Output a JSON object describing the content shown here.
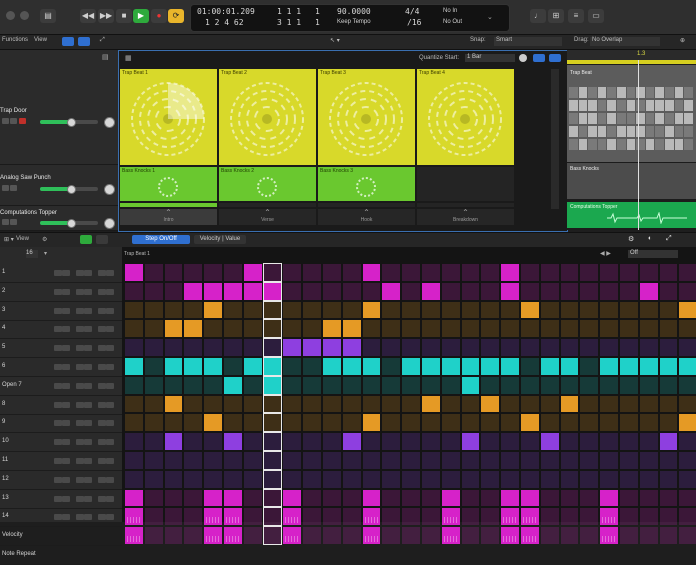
{
  "transport": {
    "position": "01:00:01.209",
    "bars_top": "1  1  1",
    "bars_top2": "1",
    "bars_bot": "1  2  4  62",
    "bars_bot2": "3  1  1",
    "bars_bot3": "1",
    "tempo": "90.0000",
    "tempo_label": "Keep Tempo",
    "time_sig": "4/4",
    "division": "/16",
    "in_label": "No In",
    "out_label": "No Out",
    "accent": "#e9b52b"
  },
  "toolbar2": {
    "functions": "Functions",
    "view": "View",
    "snap_label": "Snap:",
    "snap_value": "Smart",
    "drag_label": "Drag:",
    "drag_value": "No Overlap",
    "quantize_label": "Quantize Start:",
    "quantize_value": "1 Bar"
  },
  "tracks": [
    {
      "name": "Trap Door",
      "volume": 0.52
    },
    {
      "name": "Analog Saw Punch",
      "volume": 0.52
    },
    {
      "name": "Computations Topper",
      "volume": 0.52
    }
  ],
  "live_loops": {
    "cells_row1": [
      "Trap Beat 1",
      "Trap Beat 2",
      "Trap Beat 3",
      "Trap Beat 4"
    ],
    "cells_row2": [
      "Bass Knocks 1",
      "Bass Knocks 2",
      "Bass Knocks 3"
    ],
    "scene_triggers": [
      "Intro",
      "Verse",
      "Hook",
      "Breakdown"
    ],
    "colors": {
      "yellow": "#d8d92a",
      "green": "#6ac82f"
    }
  },
  "right_panel": {
    "region1": "Trap Beat",
    "region2": "Bass Knocks",
    "region3": "Computations Topper",
    "ruler": "1.3"
  },
  "step_sequencer": {
    "view_label": "View",
    "tab_on_off": "Step On/Off",
    "tab_velocity": "Velocity | Value",
    "pattern_name": "Trap Beat 1",
    "pattern_length": "16",
    "off_label": "Off",
    "row_labels": [
      "1",
      "2",
      "3",
      "4",
      "5",
      "6",
      "Open 7",
      "8",
      "9",
      "10",
      "11",
      "12",
      "13",
      "14",
      "Velocity",
      "Note Repeat"
    ],
    "rows": [
      {
        "color": "#d622c9",
        "steps": [
          0,
          6,
          12,
          19
        ]
      },
      {
        "color": "#d622c9",
        "steps": [
          3,
          4,
          5,
          6,
          7,
          13,
          15,
          19,
          26
        ]
      },
      {
        "color": "#e59a25",
        "steps": [
          4,
          12,
          20,
          28
        ]
      },
      {
        "color": "#e59a25",
        "steps": [
          2,
          3,
          10,
          11
        ]
      },
      {
        "color": "#8e3fe0",
        "steps": [
          8,
          9,
          10,
          11
        ]
      },
      {
        "color": "#1fd1c9",
        "steps": [
          0,
          2,
          3,
          4,
          6,
          7,
          10,
          11,
          12,
          14,
          15,
          16,
          17,
          18,
          19,
          21,
          22,
          24,
          25,
          26,
          27,
          28
        ]
      },
      {
        "color": "#1fd1c9",
        "steps": [
          5,
          7,
          17
        ]
      },
      {
        "color": "#e59a25",
        "steps": [
          2,
          15,
          18,
          22
        ]
      },
      {
        "color": "#e59a25",
        "steps": [
          4,
          12,
          20,
          28
        ]
      },
      {
        "color": "#8e3fe0",
        "steps": [
          2,
          5,
          11,
          17,
          21,
          27
        ]
      },
      {
        "color": "#8e3fe0",
        "steps": []
      },
      {
        "color": "#8e3fe0",
        "steps": []
      },
      {
        "color": "#d622c9",
        "steps": [
          0,
          4,
          5,
          8,
          12,
          16,
          19,
          20,
          24
        ]
      },
      {
        "color": "#d622c9",
        "steps": [
          0,
          4,
          5,
          8,
          12,
          16,
          19,
          20,
          24
        ]
      },
      {
        "color": "#d622c9",
        "steps": [
          0,
          4,
          5,
          8,
          12,
          16,
          19,
          20,
          24
        ]
      }
    ],
    "playhead_step": 7
  }
}
